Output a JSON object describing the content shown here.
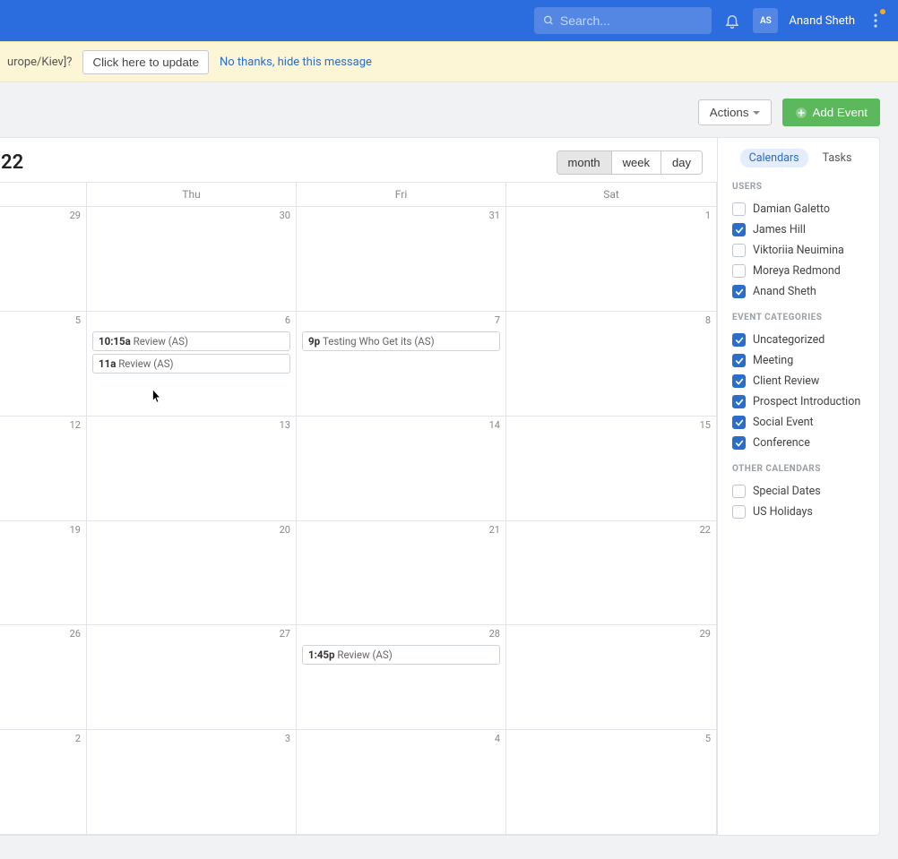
{
  "header": {
    "search_placeholder": "Search...",
    "avatar_initials": "AS",
    "username": "Anand Sheth"
  },
  "banner": {
    "tz_text": "urope/Kiev]?",
    "update_btn": "Click here to update",
    "dismiss_link": "No thanks, hide this message"
  },
  "toolbar": {
    "actions_label": "Actions",
    "add_event_label": "Add Event"
  },
  "calendar": {
    "title": "22",
    "views": {
      "month": "month",
      "week": "week",
      "day": "day"
    },
    "day_headers": [
      "",
      "Thu",
      "Fri",
      "Sat"
    ],
    "rows": [
      {
        "cells": [
          {
            "num": "29"
          },
          {
            "num": "30"
          },
          {
            "num": "31"
          },
          {
            "num": "1"
          }
        ]
      },
      {
        "cells": [
          {
            "num": "5"
          },
          {
            "num": "6",
            "events": [
              {
                "time": "10:15a",
                "label": "Review (AS)"
              },
              {
                "time": "11a",
                "label": "Review (AS)"
              }
            ]
          },
          {
            "num": "7",
            "events": [
              {
                "time": "9p",
                "label": "Testing Who Get its (AS)"
              }
            ]
          },
          {
            "num": "8"
          }
        ]
      },
      {
        "cells": [
          {
            "num": "12"
          },
          {
            "num": "13"
          },
          {
            "num": "14"
          },
          {
            "num": "15"
          }
        ]
      },
      {
        "cells": [
          {
            "num": "19"
          },
          {
            "num": "20"
          },
          {
            "num": "21"
          },
          {
            "num": "22"
          }
        ]
      },
      {
        "cells": [
          {
            "num": "26"
          },
          {
            "num": "27"
          },
          {
            "num": "28",
            "events": [
              {
                "time": "1:45p",
                "label": "Review (AS)"
              }
            ]
          },
          {
            "num": "29"
          }
        ]
      },
      {
        "cells": [
          {
            "num": "2"
          },
          {
            "num": "3"
          },
          {
            "num": "4"
          },
          {
            "num": "5"
          }
        ]
      }
    ]
  },
  "sidebar": {
    "tabs": {
      "calendars": "Calendars",
      "tasks": "Tasks"
    },
    "sections": {
      "users": {
        "title": "USERS",
        "items": [
          {
            "label": "Damian Galetto",
            "checked": false
          },
          {
            "label": "James Hill",
            "checked": true
          },
          {
            "label": "Viktoriia Neuimina",
            "checked": false
          },
          {
            "label": "Moreya Redmond",
            "checked": false
          },
          {
            "label": "Anand Sheth",
            "checked": true
          }
        ]
      },
      "categories": {
        "title": "EVENT CATEGORIES",
        "items": [
          {
            "label": "Uncategorized",
            "checked": true
          },
          {
            "label": "Meeting",
            "checked": true
          },
          {
            "label": "Client Review",
            "checked": true
          },
          {
            "label": "Prospect Introduction",
            "checked": true
          },
          {
            "label": "Social Event",
            "checked": true
          },
          {
            "label": "Conference",
            "checked": true
          }
        ]
      },
      "other": {
        "title": "OTHER CALENDARS",
        "items": [
          {
            "label": "Special Dates",
            "checked": false
          },
          {
            "label": "US Holidays",
            "checked": false
          }
        ]
      }
    }
  }
}
